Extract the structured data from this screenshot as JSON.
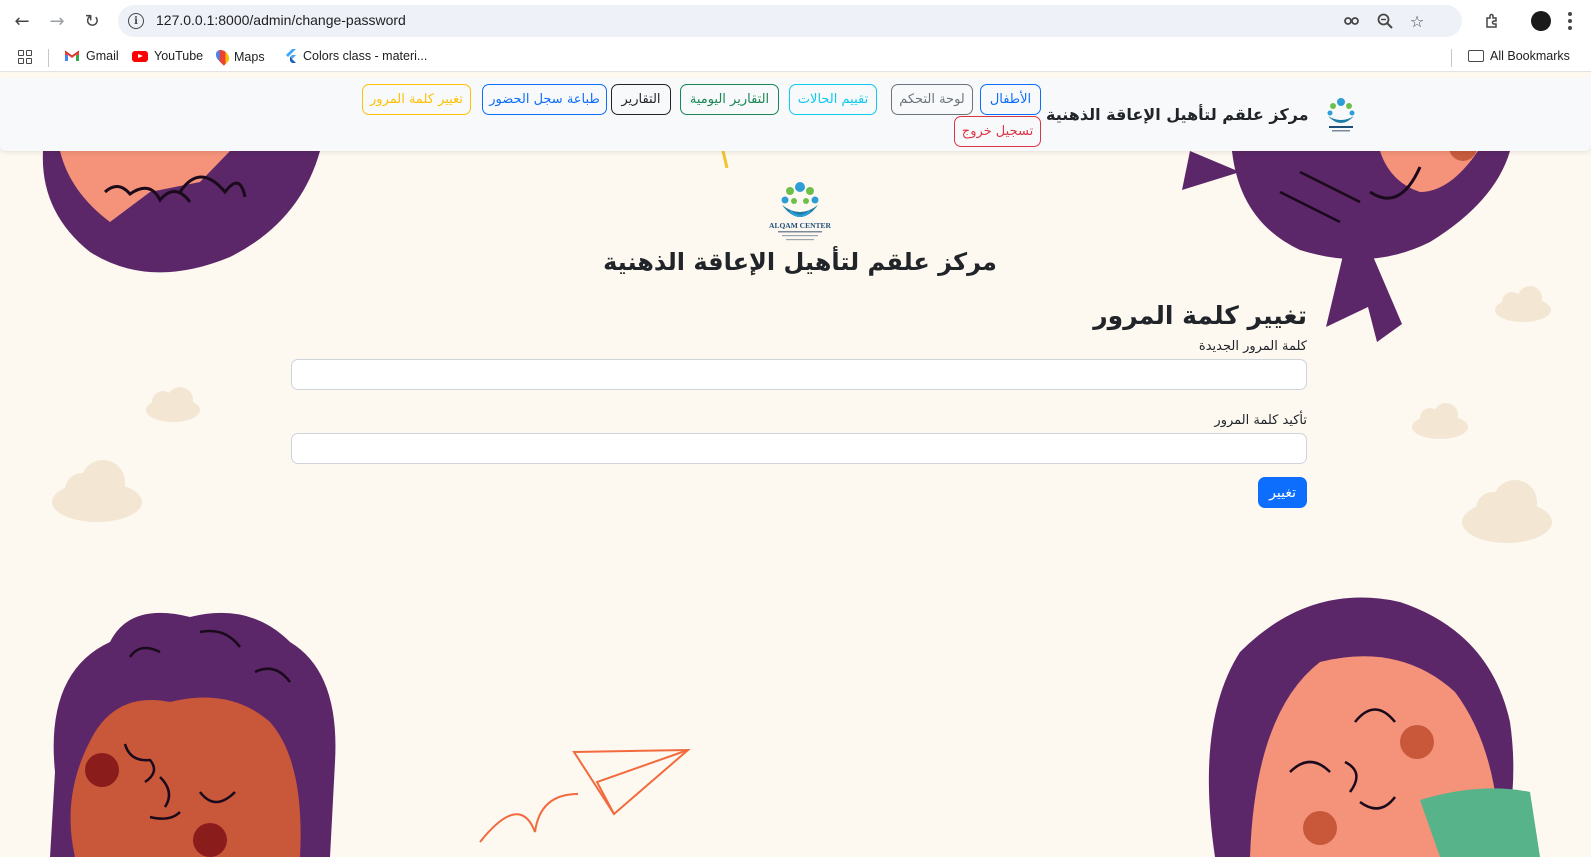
{
  "browser": {
    "url": "127.0.0.1:8000/admin/change-password",
    "bookmarks": [
      {
        "label": "Gmail",
        "icon": "gmail-icon"
      },
      {
        "label": "YouTube",
        "icon": "youtube-icon"
      },
      {
        "label": "Maps",
        "icon": "maps-icon"
      },
      {
        "label": "Colors class - materi...",
        "icon": "flutter-icon"
      }
    ],
    "all_bookmarks_label": "All Bookmarks"
  },
  "navbar": {
    "brand": "مركز علقم لتأهيل الإعاقة الذهنية",
    "buttons": [
      {
        "label": "الأطفال",
        "style": "primary"
      },
      {
        "label": "لوحة التحكم",
        "style": "secondary"
      },
      {
        "label": "تقييم الحالات",
        "style": "info"
      },
      {
        "label": "التقارير اليومية",
        "style": "success"
      },
      {
        "label": "التقارير",
        "style": "dark"
      },
      {
        "label": "طباعة سجل الحضور",
        "style": "primary"
      },
      {
        "label": "تغيير كلمة المرور",
        "style": "warning"
      }
    ],
    "logout": "تسجيل خروج"
  },
  "header": {
    "logo_text": "ALQAM CENTER",
    "title": "مركز علقم لتأهيل الإعاقة الذهنية"
  },
  "form": {
    "title": "تغيير كلمة المرور",
    "new_password_label": "كلمة المرور الجديدة",
    "new_password_value": "",
    "confirm_label": "تأكيد كلمة المرور",
    "confirm_value": "",
    "submit_label": "تغيير"
  },
  "colors": {
    "primary": "#0d6efd",
    "page_background": "#fdf9f1",
    "hair_purple": "#5b2768",
    "skin": "#f4937a"
  }
}
